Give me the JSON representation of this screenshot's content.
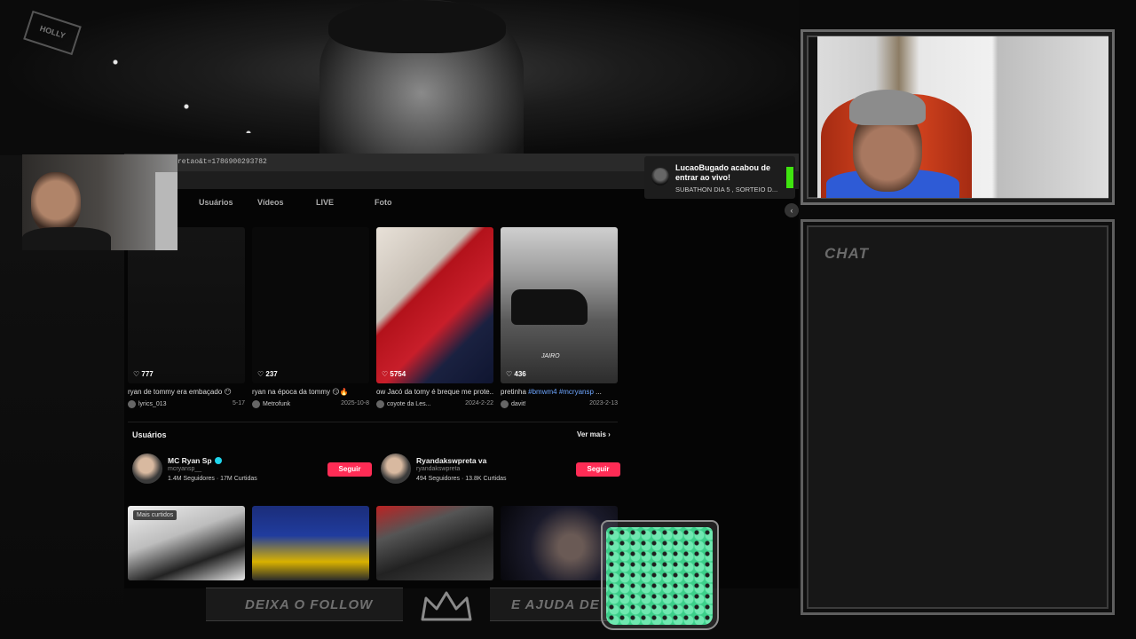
{
  "background": {
    "logo_text": "HOLLY"
  },
  "browser": {
    "url": "retao&t=1786900293782",
    "tabs": [
      {
        "label": "Usuários"
      },
      {
        "label": "Vídeos"
      },
      {
        "label": "LIVE"
      },
      {
        "label": "Foto"
      }
    ],
    "videos": [
      {
        "likes": "777",
        "caption": "ryan de tommy era embaçado 😶",
        "author": "lyrics_013",
        "date": "5-17",
        "style": "dark1"
      },
      {
        "likes": "237",
        "caption": "ryan na época da tommy 😏🔥",
        "author": "Metrofunk",
        "date": "2025-10-8",
        "style": "dark2"
      },
      {
        "likes": "5754",
        "caption": "ow Jacó da tomy é breque me prote...",
        "author": "coyote da Les...",
        "date": "2024-2-22",
        "style": "red"
      },
      {
        "likes": "436",
        "caption_prefix": "pretinha ",
        "caption_tags": "#bmwm4 #mcryansp",
        "caption_suffix": " ...",
        "author": "davit!",
        "date": "2023-2-13",
        "style": "car",
        "thumb_label": "JAIRO"
      }
    ],
    "users_section": {
      "title": "Usuários",
      "see_more": "Ver mais ›",
      "users": [
        {
          "name": "MC Ryan Sp",
          "verified": true,
          "handle": "mcryansp__",
          "stats": "1.4M Seguidores  ·  17M Curtidas",
          "follow": "Seguir"
        },
        {
          "name": "Ryandakswpreta va",
          "verified": false,
          "handle": "ryandakswpreta",
          "stats": "494 Seguidores  ·  13.8K Curtidas",
          "follow": "Seguir"
        }
      ]
    },
    "bottom_videos": [
      {
        "badge": "Mais curtidos",
        "style": "b1"
      },
      {
        "badge": "",
        "style": "b2"
      },
      {
        "badge": "",
        "style": "b3"
      },
      {
        "badge": "",
        "style": "b4"
      }
    ]
  },
  "notification": {
    "title": "LucaoBugado acabou de entrar ao vivo!",
    "subtitle": "SUBATHON DIA 5 , SORTEIO D...",
    "accent": "#3fe40f"
  },
  "chat": {
    "title": "CHAT"
  },
  "bottom_banner": {
    "left_text": "DEIXA O FOLLOW",
    "right_text": "E AJUDA DE"
  },
  "colors": {
    "follow_button": "#fe2c55",
    "verified": "#20d5ec",
    "jar_fill": "#3ccf8a"
  }
}
